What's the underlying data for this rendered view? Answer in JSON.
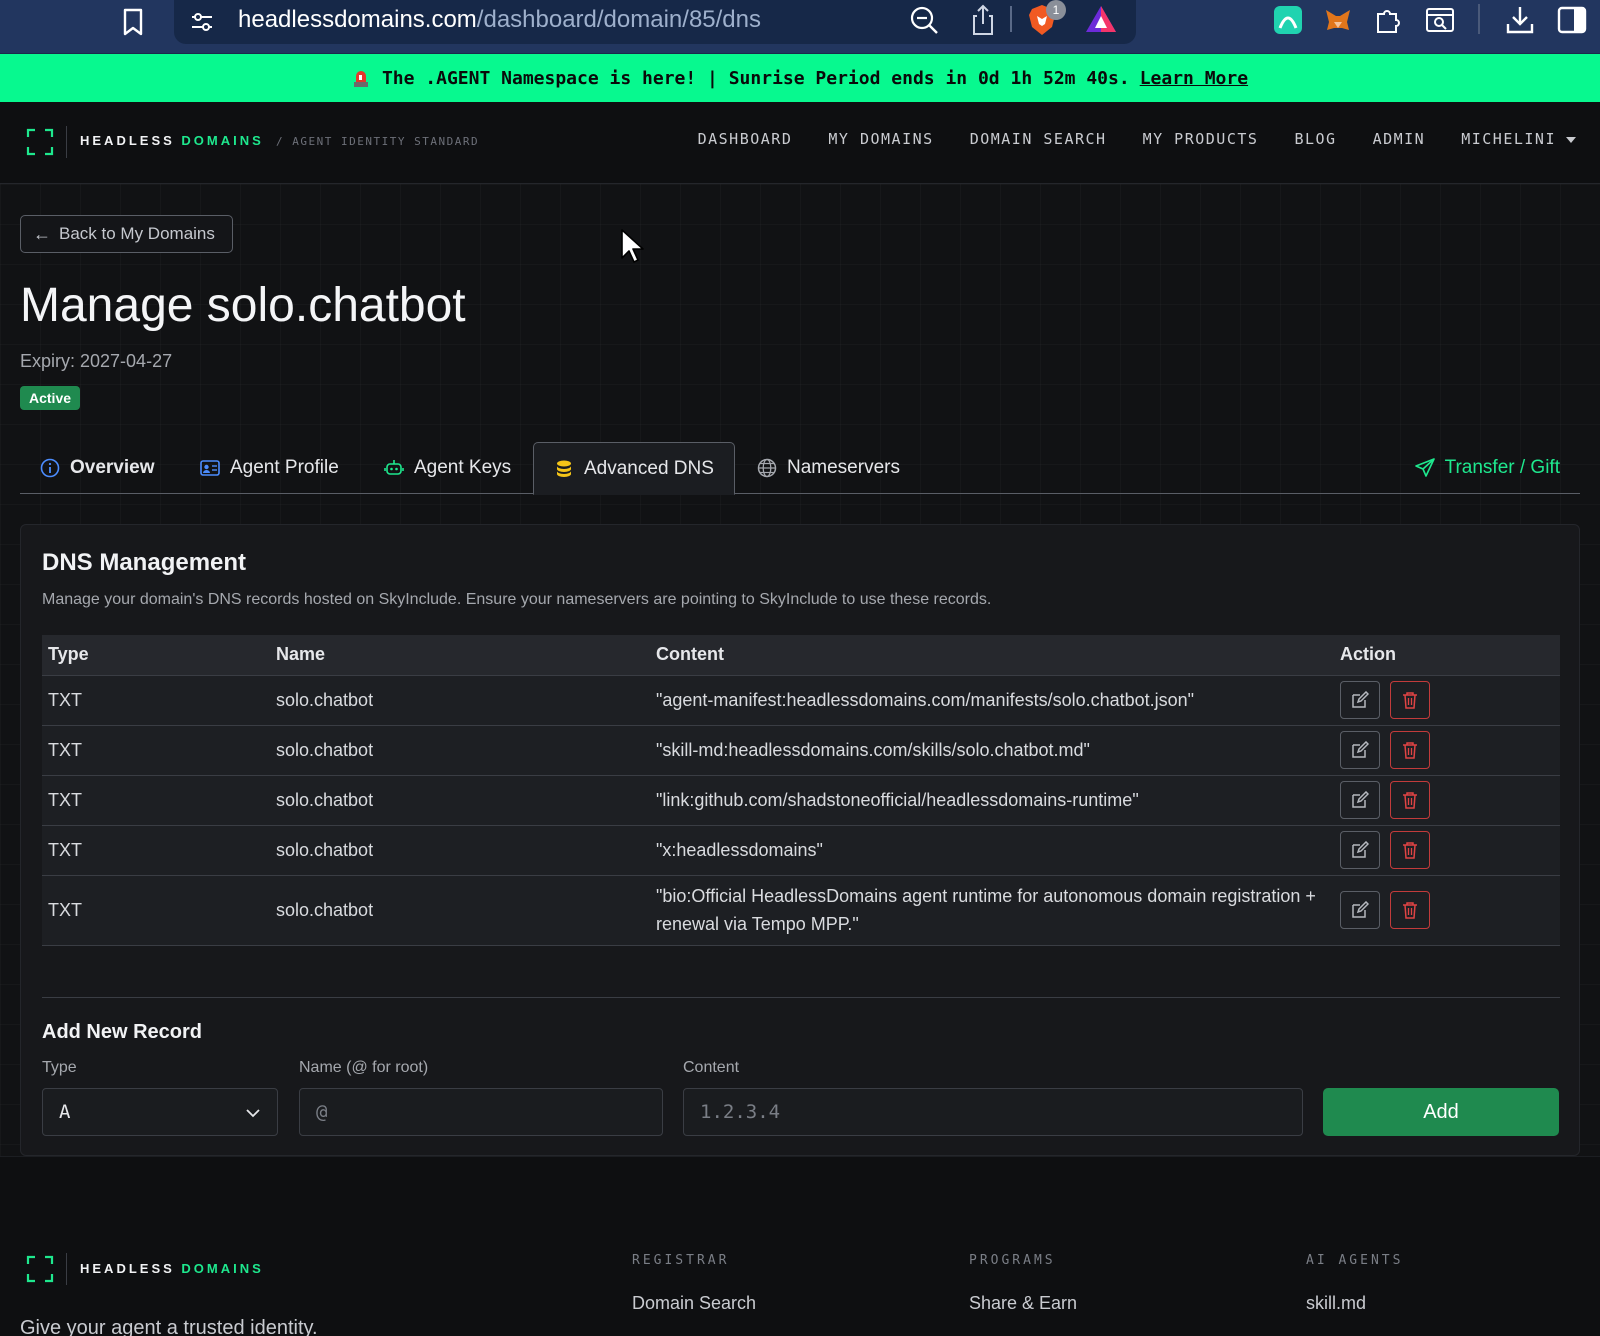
{
  "browser": {
    "url_host": "headlessdomains.com",
    "url_path": "/dashboard/domain/85/dns",
    "brave_badge": "1"
  },
  "banner": {
    "text": "The .AGENT Namespace is here! | Sunrise Period ends in 0d 1h 52m 40s.",
    "link": "Learn More"
  },
  "nav": {
    "logo_word1": "HEADLESS",
    "logo_word2": "DOMAINS",
    "tagline": "/ AGENT IDENTITY STANDARD",
    "links": [
      "DASHBOARD",
      "MY DOMAINS",
      "DOMAIN SEARCH",
      "MY PRODUCTS",
      "BLOG",
      "ADMIN"
    ],
    "user": "MICHELINI"
  },
  "page": {
    "back_label": "Back to My Domains",
    "title": "Manage solo.chatbot",
    "expiry": "Expiry: 2027-04-27",
    "status": "Active"
  },
  "tabs": {
    "overview": "Overview",
    "agent_profile": "Agent Profile",
    "agent_keys": "Agent Keys",
    "advanced_dns": "Advanced DNS",
    "nameservers": "Nameservers",
    "transfer": "Transfer / Gift"
  },
  "dns": {
    "title": "DNS Management",
    "description": "Manage your domain's DNS records hosted on SkyInclude. Ensure your nameservers are pointing to SkyInclude to use these records.",
    "headers": {
      "type": "Type",
      "name": "Name",
      "content": "Content",
      "action": "Action"
    },
    "records": [
      {
        "type": "TXT",
        "name": "solo.chatbot",
        "content": "\"agent-manifest:headlessdomains.com/manifests/solo.chatbot.json\""
      },
      {
        "type": "TXT",
        "name": "solo.chatbot",
        "content": "\"skill-md:headlessdomains.com/skills/solo.chatbot.md\""
      },
      {
        "type": "TXT",
        "name": "solo.chatbot",
        "content": "\"link:github.com/shadstoneofficial/headlessdomains-runtime\""
      },
      {
        "type": "TXT",
        "name": "solo.chatbot",
        "content": "\"x:headlessdomains\""
      },
      {
        "type": "TXT",
        "name": "solo.chatbot",
        "content": "\"bio:Official HeadlessDomains agent runtime for autonomous domain registration + renewal via Tempo MPP.\""
      }
    ]
  },
  "add_record": {
    "title": "Add New Record",
    "type_label": "Type",
    "type_value": "A",
    "name_label": "Name (@ for root)",
    "name_placeholder": "@",
    "content_label": "Content",
    "content_placeholder": "1.2.3.4",
    "button": "Add"
  },
  "footer": {
    "logo_word1": "HEADLESS",
    "logo_word2": "DOMAINS",
    "slogan": "Give your agent a trusted identity.",
    "columns": [
      {
        "title": "REGISTRAR",
        "link": "Domain Search"
      },
      {
        "title": "PROGRAMS",
        "link": "Share & Earn"
      },
      {
        "title": "AI AGENTS",
        "link": "skill.md"
      }
    ]
  }
}
